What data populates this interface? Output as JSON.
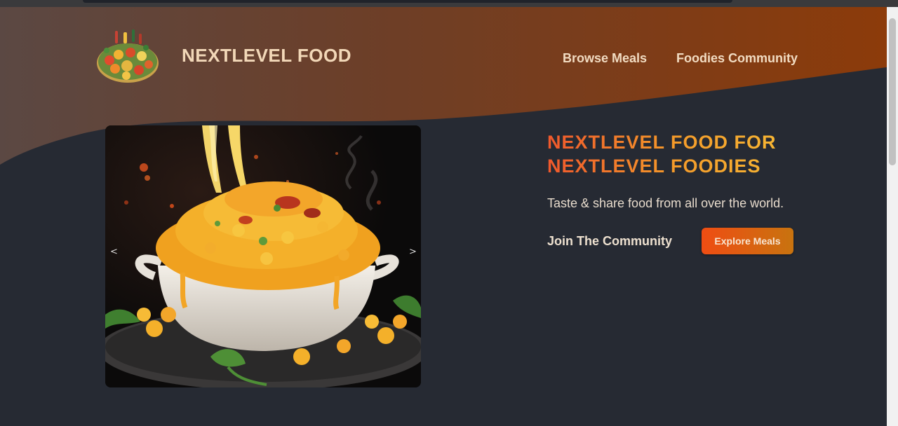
{
  "header": {
    "brand_title": "NEXTLEVEL FOOD",
    "logo_icon": "food-platter-icon",
    "nav": [
      {
        "label": "Browse Meals"
      },
      {
        "label": "Foodies Community"
      }
    ]
  },
  "hero": {
    "heading_line1": "NEXTLEVEL FOOD FOR",
    "heading_line2": "NEXTLEVEL FOODIES",
    "subtitle": "Taste & share food from all over the world.",
    "join_label": "Join The Community",
    "explore_label": "Explore Meals"
  },
  "slideshow": {
    "prev_label": "<",
    "next_label": ">",
    "image_subject": "mac-and-cheese-icon"
  },
  "colors": {
    "background": "#262a33",
    "header_gradient_start": "#5a4540",
    "header_gradient_end": "#8a3a0c",
    "heading_gradient_start": "#f0582c",
    "heading_gradient_end": "#f7b533",
    "button_gradient_start": "#ef4d13",
    "button_gradient_end": "#c8730f"
  }
}
